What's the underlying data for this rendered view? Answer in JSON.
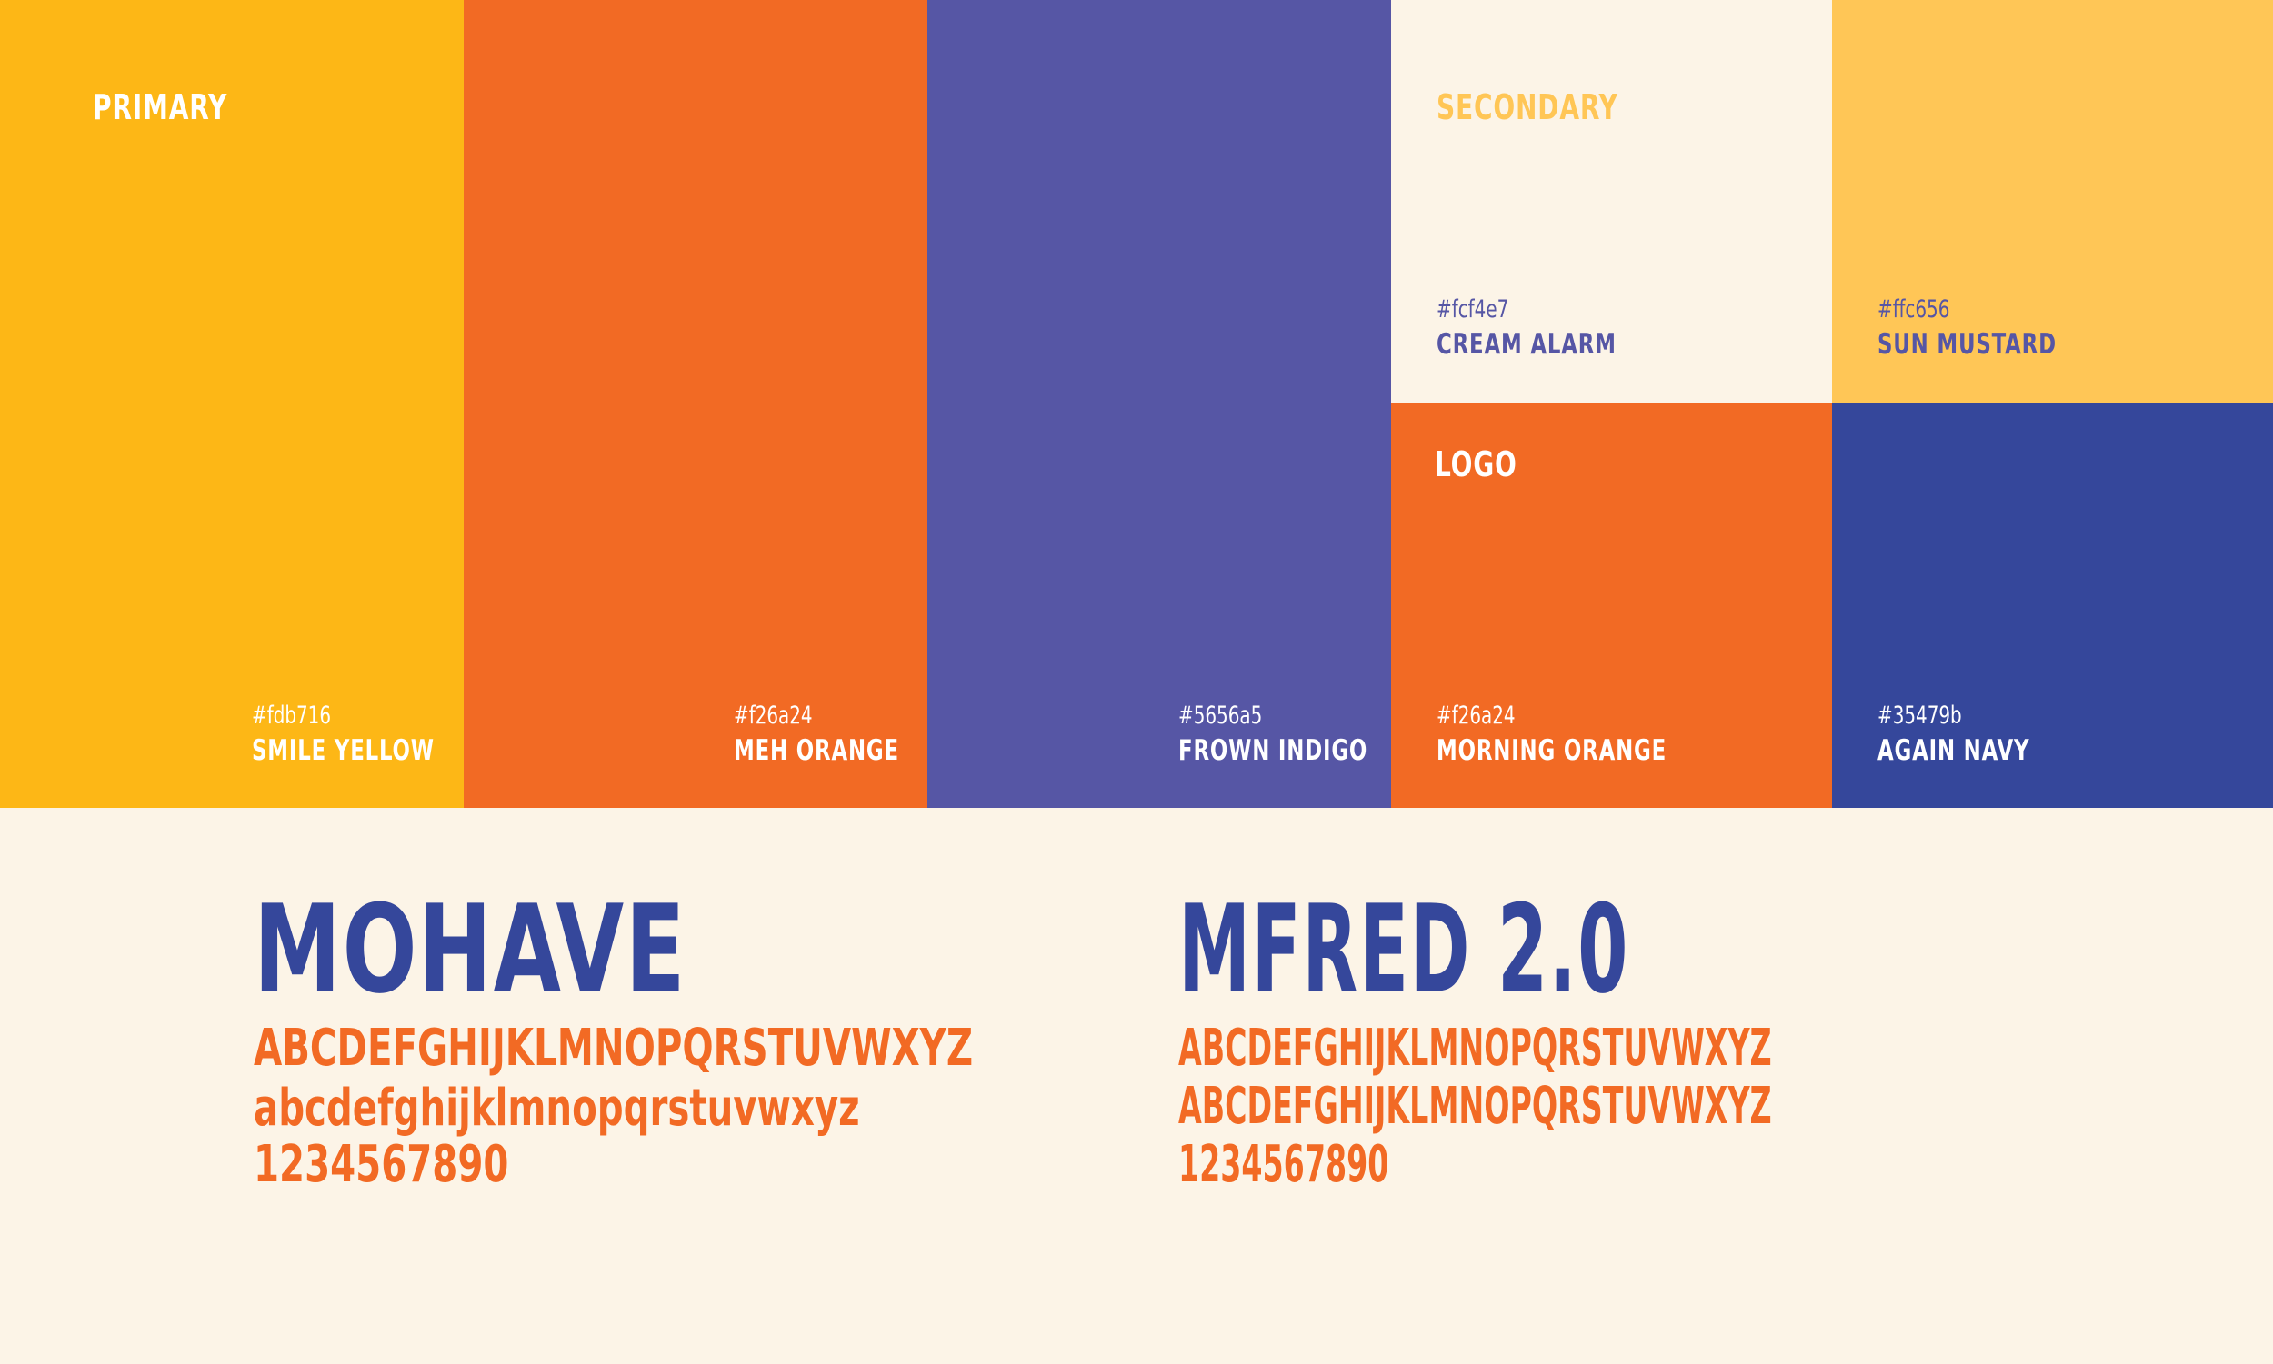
{
  "palette": {
    "primary_label": "PRIMARY",
    "secondary_label": "SECONDARY",
    "logo_label": "LOGO",
    "colors": [
      {
        "hex": "#fdb716",
        "name": "SMILE YELLOW"
      },
      {
        "hex": "#f26a24",
        "name": "MEH ORANGE"
      },
      {
        "hex": "#5656a5",
        "name": "FROWN INDIGO"
      },
      {
        "hex": "#fcf4e7",
        "name": "CREAM ALARM"
      },
      {
        "hex": "#ffc656",
        "name": "SUN MUSTARD"
      },
      {
        "hex": "#f26a24",
        "name": "MORNING ORANGE"
      },
      {
        "hex": "#35479b",
        "name": "AGAIN NAVY"
      }
    ]
  },
  "typography": {
    "fonts": [
      {
        "name": "MOHAVE",
        "uppercase": "ABCDEFGHIJKLMNOPQRSTUVWXYZ",
        "lowercase": "abcdefghijklmnopqrstuvwxyz",
        "digits": "1234567890"
      },
      {
        "name": "MFRED 2.0",
        "uppercase": "ABCDEFGHIJKLMNOPQRSTUVWXYZ",
        "lowercase": "ABCDEFGHIJKLMNOPQRSTUVWXYZ",
        "digits": "1234567890"
      }
    ]
  }
}
